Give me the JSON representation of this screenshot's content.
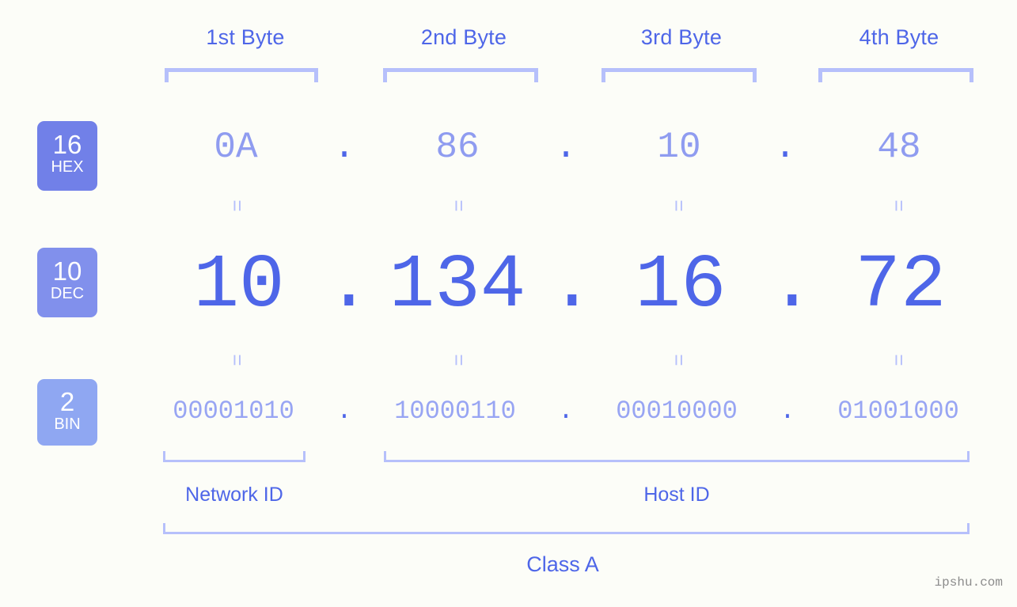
{
  "meta": {
    "background_color": "#fcfdf8",
    "accent_color": "#4e66e8",
    "muted_color": "#8f9cf0",
    "bracket_color": "#b6c0fb",
    "watermark": "ipshu.com"
  },
  "byte_headers": [
    {
      "label": "1st Byte"
    },
    {
      "label": "2nd Byte"
    },
    {
      "label": "3rd Byte"
    },
    {
      "label": "4th Byte"
    }
  ],
  "bases": [
    {
      "number": "16",
      "name": "HEX",
      "color": "#7180e8"
    },
    {
      "number": "10",
      "name": "DEC",
      "color": "#8190ec"
    },
    {
      "number": "2",
      "name": "BIN",
      "color": "#8fa7f2"
    }
  ],
  "rows": {
    "hex": {
      "base_number": "16",
      "base_name": "HEX",
      "values": [
        "0A",
        "86",
        "10",
        "48"
      ],
      "separator": "."
    },
    "dec": {
      "base_number": "10",
      "base_name": "DEC",
      "values": [
        "10",
        "134",
        "16",
        "72"
      ],
      "separator": "."
    },
    "bin": {
      "base_number": "2",
      "base_name": "BIN",
      "values": [
        "00001010",
        "10000110",
        "00010000",
        "01001000"
      ],
      "separator": "."
    }
  },
  "equals_glyph": "=",
  "footer": {
    "network_id_label": "Network ID",
    "host_id_label": "Host ID",
    "class_label": "Class A"
  }
}
